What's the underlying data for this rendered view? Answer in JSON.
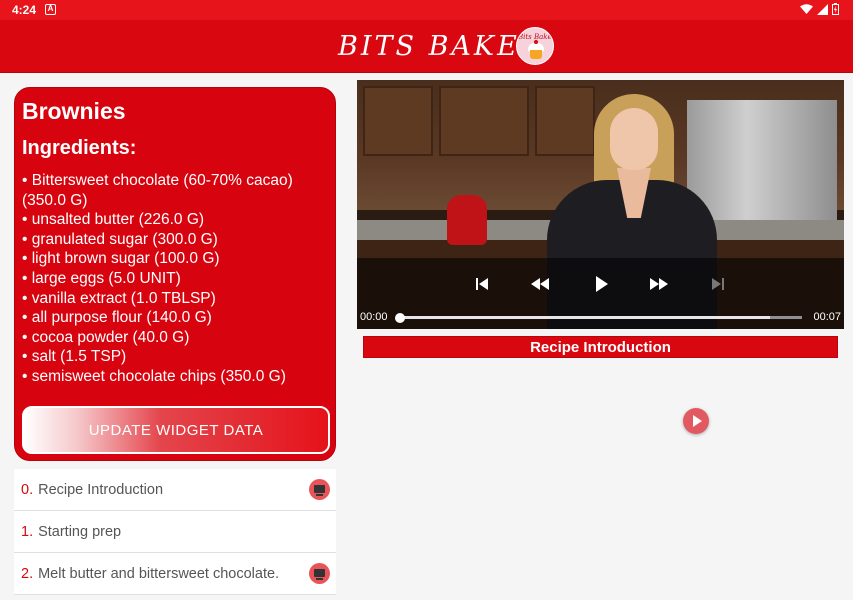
{
  "status_bar": {
    "time": "4:24",
    "notification_glyph": "A"
  },
  "app_bar": {
    "brand": "BITS BAKE",
    "logo_text": "Bits Bake"
  },
  "recipe": {
    "title": "Brownies",
    "ingredients_heading": "Ingredients:",
    "ingredients": [
      "• Bittersweet chocolate (60-70% cacao) (350.0 G)",
      "• unsalted butter (226.0 G)",
      "• granulated sugar (300.0 G)",
      "• light brown sugar (100.0 G)",
      "• large eggs (5.0 UNIT)",
      "• vanilla extract (1.0 TBLSP)",
      "• all purpose flour (140.0 G)",
      "• cocoa powder (40.0 G)",
      "• salt (1.5 TSP)",
      "• semisweet chocolate chips (350.0 G)"
    ],
    "update_button": "UPDATE WIDGET DATA"
  },
  "steps": [
    {
      "num": "0.",
      "label": "Recipe Introduction",
      "has_video": true
    },
    {
      "num": "1.",
      "label": "Starting prep",
      "has_video": false
    },
    {
      "num": "2.",
      "label": "Melt butter and bittersweet chocolate.",
      "has_video": true
    }
  ],
  "player": {
    "position": "00:00",
    "duration": "00:07",
    "progress_fraction": 0.0,
    "buffered_fraction": 0.92,
    "step_title": "Recipe Introduction"
  },
  "colors": {
    "primary": "#d80710",
    "status_bar": "#e8141c",
    "accent": "#e25a61"
  }
}
